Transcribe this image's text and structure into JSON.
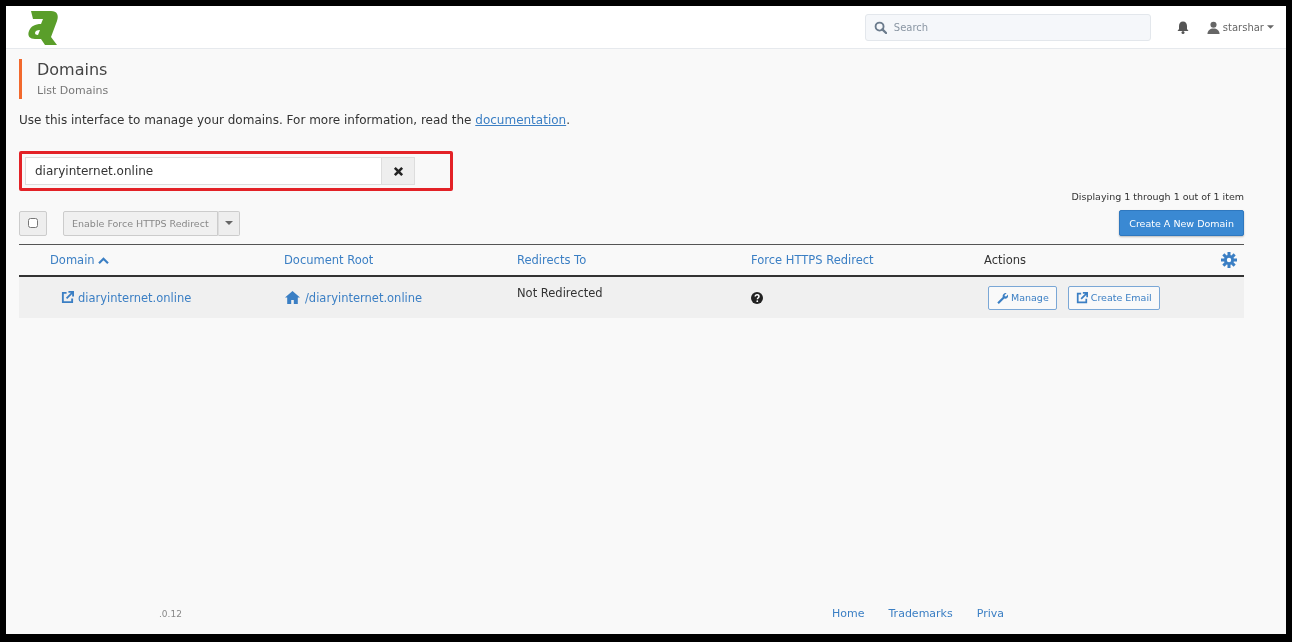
{
  "header": {
    "search": {
      "placeholder": "Search"
    },
    "user": {
      "name": "starshar"
    }
  },
  "page": {
    "title": "Domains",
    "subtitle": "List Domains",
    "description": {
      "before": "Use this interface to manage your domains. For more information, read the ",
      "link": "documentation",
      "after": "."
    }
  },
  "filter": {
    "value": "diaryinternet.online",
    "highlighted": true
  },
  "status": "Displaying 1 through 1 out of 1 item",
  "bulk": {
    "checked": false,
    "action": "Enable Force HTTPS Redirect",
    "disabled": true
  },
  "create_button": "Create A New Domain",
  "table": {
    "columns": [
      {
        "label": "Domain",
        "kind": "link",
        "sorted": true
      },
      {
        "label": "Document Root",
        "kind": "link",
        "sorted": false
      },
      {
        "label": "Redirects To",
        "kind": "link",
        "sorted": false
      },
      {
        "label": "Force HTTPS Redirect",
        "kind": "link",
        "sorted": false
      },
      {
        "label": "Actions",
        "kind": "plain",
        "sorted": false
      }
    ],
    "rows": [
      {
        "domain": "diaryinternet.online",
        "document_root": "/diaryinternet.online",
        "redirects_to": "Not Redirected",
        "actions": [
          {
            "label": "Manage",
            "kind": "wrench"
          },
          {
            "label": "Create Email",
            "kind": "external"
          }
        ]
      }
    ]
  },
  "footer": {
    "version": ".0.12",
    "links": [
      "Home",
      "Trademarks",
      "Priva"
    ]
  }
}
